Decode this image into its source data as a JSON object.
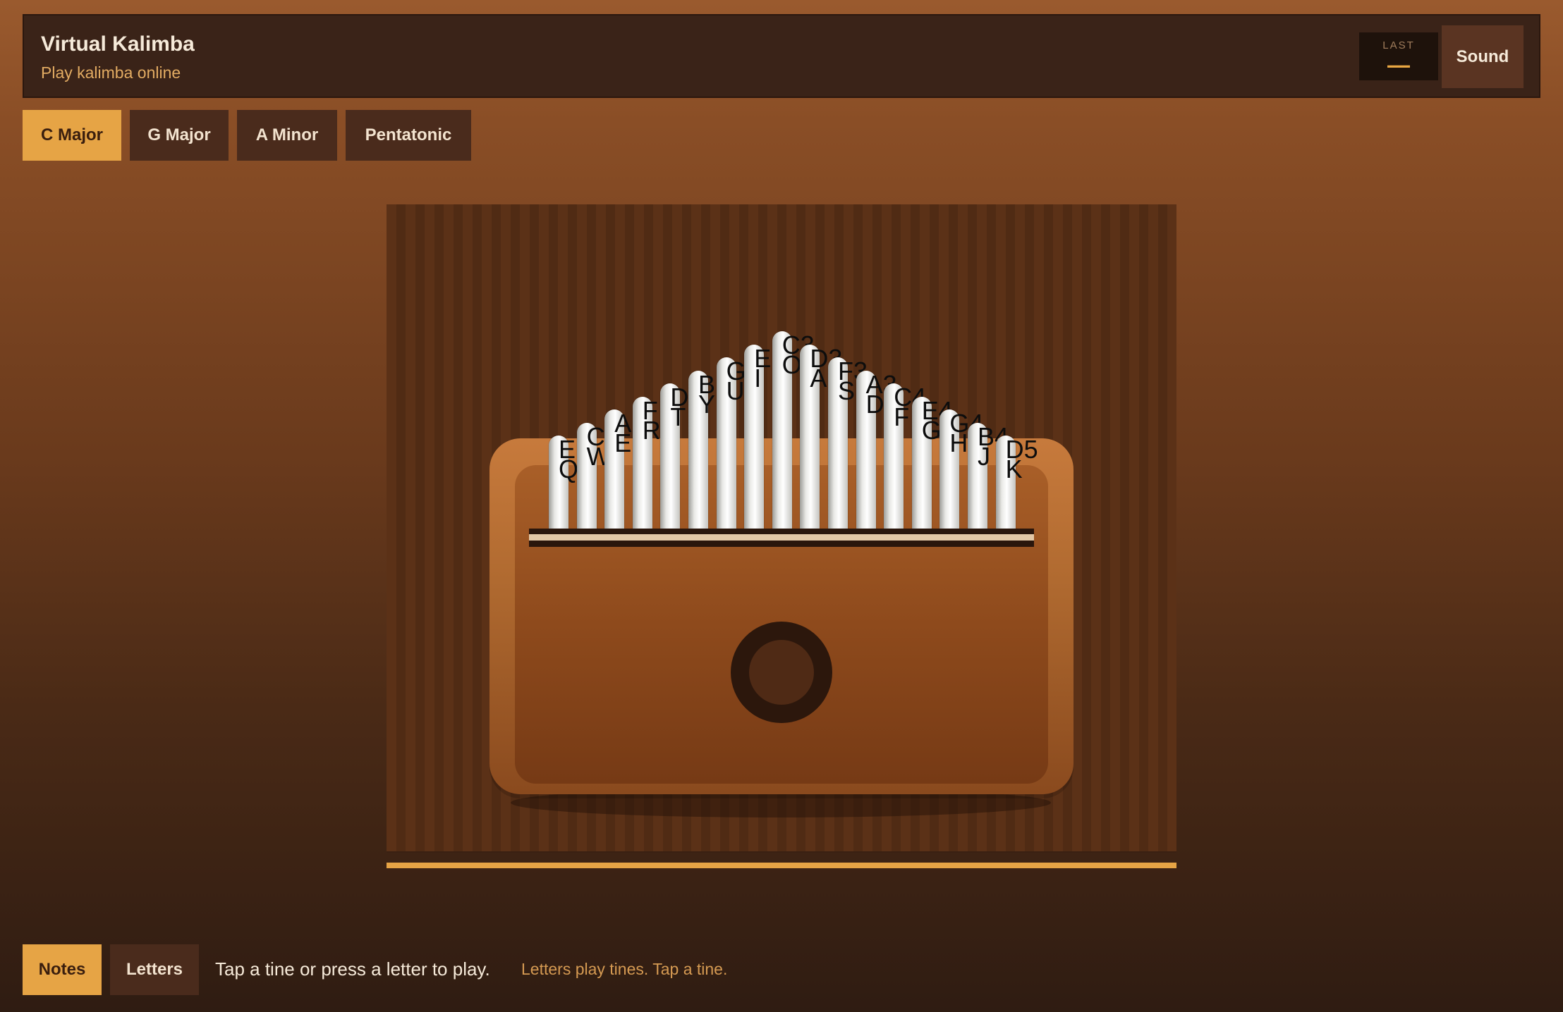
{
  "header": {
    "title": "Virtual Kalimba",
    "subtitle": "Play kalimba online",
    "last_label": "LAST",
    "last_value": "—",
    "sound_label": "Sound"
  },
  "scales": [
    {
      "label": "C Major",
      "active": true
    },
    {
      "label": "G Major",
      "active": false
    },
    {
      "label": "A Minor",
      "active": false
    },
    {
      "label": "Pentatonic",
      "active": false
    }
  ],
  "tines": [
    {
      "note": "E",
      "key": "Q"
    },
    {
      "note": "C",
      "key": "W"
    },
    {
      "note": "A",
      "key": "E"
    },
    {
      "note": "F",
      "key": "R"
    },
    {
      "note": "D",
      "key": "T"
    },
    {
      "note": "B",
      "key": "Y"
    },
    {
      "note": "G",
      "key": "U"
    },
    {
      "note": "E",
      "key": "I"
    },
    {
      "note": "C3",
      "key": "O"
    },
    {
      "note": "D3",
      "key": "A"
    },
    {
      "note": "F3",
      "key": "S"
    },
    {
      "note": "A3",
      "key": "D"
    },
    {
      "note": "C4",
      "key": "F"
    },
    {
      "note": "E4",
      "key": "G"
    },
    {
      "note": "G4",
      "key": "H"
    },
    {
      "note": "B4",
      "key": "J"
    },
    {
      "note": "D5",
      "key": "K"
    }
  ],
  "modes": [
    {
      "label": "Notes",
      "active": true
    },
    {
      "label": "Letters",
      "active": false
    }
  ],
  "hint_main": "Tap a tine or press a letter to play.",
  "hint_sub": "Letters play tines. Tap a tine."
}
